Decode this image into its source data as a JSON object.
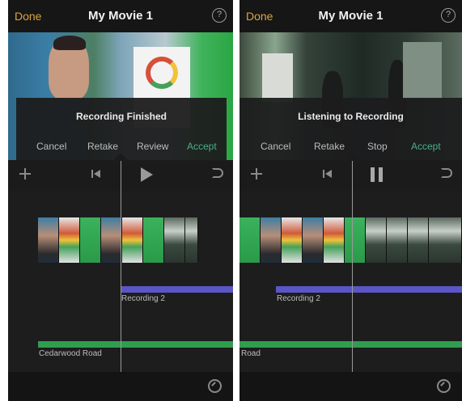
{
  "screens": [
    {
      "header": {
        "done_label": "Done",
        "title": "My Movie 1",
        "help_glyph": "?"
      },
      "popup": {
        "title": "Recording Finished",
        "buttons": [
          "Cancel",
          "Retake",
          "Review",
          "Accept"
        ],
        "accent_button": "Accept"
      },
      "transport": {
        "state": "play"
      },
      "timeline": {
        "voiceover_label": "Recording 2",
        "music_label": "Cedarwood Road"
      }
    },
    {
      "header": {
        "done_label": "Done",
        "title": "My Movie 1",
        "help_glyph": "?"
      },
      "popup": {
        "title": "Listening to Recording",
        "buttons": [
          "Cancel",
          "Retake",
          "Stop",
          "Accept"
        ],
        "accent_button": "Accept"
      },
      "transport": {
        "state": "pause"
      },
      "timeline": {
        "voiceover_label": "Recording 2",
        "music_label": "Road"
      }
    }
  ],
  "colors": {
    "accent_orange": "#d9a63f",
    "accept_green": "#46b08d",
    "voiceover_purple": "#5b56c8",
    "music_green": "#2f9e4f"
  },
  "icons": [
    "help-icon",
    "add-media-icon",
    "skip-back-icon",
    "play-icon",
    "pause-icon",
    "undo-icon",
    "settings-icon"
  ]
}
